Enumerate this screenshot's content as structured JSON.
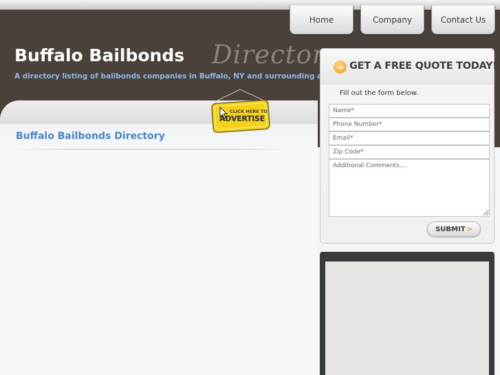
{
  "nav": {
    "items": [
      {
        "label": "Home"
      },
      {
        "label": "Company"
      },
      {
        "label": "Contact Us"
      }
    ]
  },
  "header": {
    "site_title": "Buffalo Bailbonds",
    "directory_word": "Directory",
    "tagline": "A directory listing of bailbonds companies in Buffalo, NY and surrounding areas"
  },
  "advertise": {
    "small_text": "CLICK HERE TO",
    "big_text": "ADVERTISE"
  },
  "main": {
    "heading": "Buffalo Bailbonds Directory"
  },
  "quote_form": {
    "title": "GET A FREE QUOTE TODAY!",
    "subtitle": "Fill out the form below.",
    "name_placeholder": "Name*",
    "phone_placeholder": "Phone Number*",
    "email_placeholder": "Email*",
    "zip_placeholder": "Zip Code*",
    "comments_placeholder": "Additional Comments...",
    "submit_label": "SUBMIT",
    "submit_chevron": ">"
  },
  "colors": {
    "header_bg": "#4a423a",
    "heading_blue": "#4b86cc",
    "tagline_blue": "#8fb8e8",
    "accent_orange": "#f0a020",
    "badge_yellow": "#f5d21a"
  },
  "icons": {
    "quote_arrow": "arrow-right-circle-icon",
    "advertise_cursor": "cursor-pointer-icon"
  }
}
